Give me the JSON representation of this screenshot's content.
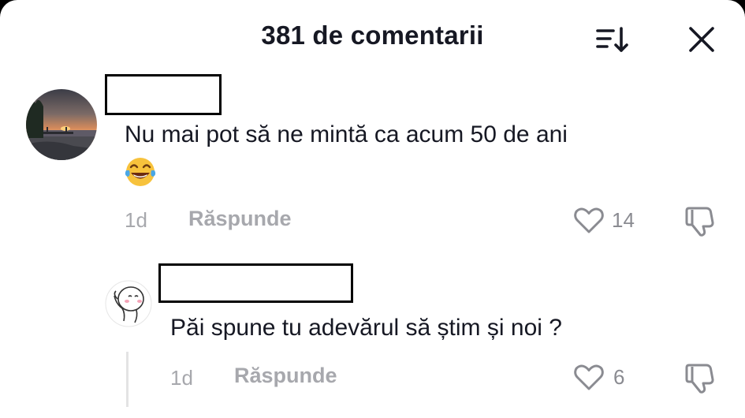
{
  "header": {
    "title": "381 de comentarii",
    "sort_icon": "sort-icon",
    "close_icon": "close-icon"
  },
  "comments": [
    {
      "text_line1": "Nu mai pot să ne mintă ca acum 50 de ani",
      "emoji": "😂",
      "time": "1d",
      "reply_label": "Răspunde",
      "likes": "14",
      "avatar": "sunset-lake-photo"
    },
    {
      "text_line1": "Păi spune tu adevărul să știm și noi ?",
      "time": "1d",
      "reply_label": "Răspunde",
      "likes": "6",
      "avatar": "cartoon-character"
    }
  ],
  "colors": {
    "text": "#161823",
    "muted": "#a7a8ad",
    "background": "#ffffff"
  }
}
